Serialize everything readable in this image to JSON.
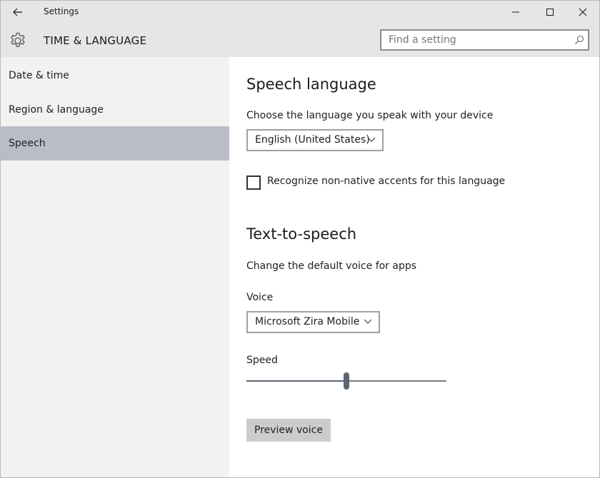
{
  "window": {
    "title": "Settings"
  },
  "header": {
    "section_title": "TIME & LANGUAGE",
    "search_placeholder": "Find a setting"
  },
  "sidebar": {
    "items": [
      {
        "label": "Date & time",
        "selected": false
      },
      {
        "label": "Region & language",
        "selected": false
      },
      {
        "label": "Speech",
        "selected": true
      }
    ]
  },
  "speech_language": {
    "heading": "Speech language",
    "description": "Choose the language you speak with your device",
    "language_value": "English (United States)",
    "accents_label": "Recognize non-native accents for this language",
    "accents_checked": false
  },
  "tts": {
    "heading": "Text-to-speech",
    "description": "Change the default voice for apps",
    "voice_label": "Voice",
    "voice_value": "Microsoft Zira Mobile",
    "speed_label": "Speed",
    "speed_fraction": 0.5,
    "preview_label": "Preview voice"
  },
  "colors": {
    "selected_nav": "#b9bdc5",
    "slider_accent": "#5a6573"
  },
  "icons": {
    "back": "back-arrow-icon",
    "minimize": "minimize-icon",
    "maximize": "maximize-icon",
    "close": "close-icon",
    "settings": "gear-icon",
    "search": "search-icon",
    "dropdown": "chevron-down-icon"
  }
}
